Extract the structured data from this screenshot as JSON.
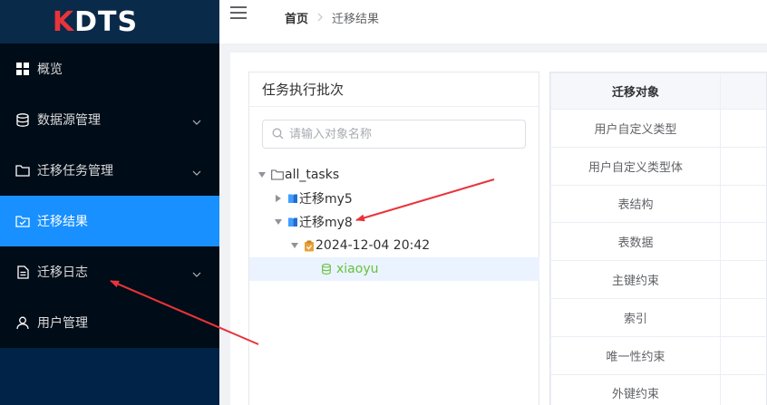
{
  "app": {
    "logo_k": "K",
    "logo_rest": "DTS"
  },
  "sidebar": {
    "items": [
      {
        "label": "概览",
        "icon": "grid-icon",
        "has_arrow": false,
        "active": false
      },
      {
        "label": "数据源管理",
        "icon": "database-icon",
        "has_arrow": true,
        "active": false
      },
      {
        "label": "迁移任务管理",
        "icon": "folder-icon",
        "has_arrow": true,
        "active": false
      },
      {
        "label": "迁移结果",
        "icon": "folder-check-icon",
        "has_arrow": false,
        "active": true
      },
      {
        "label": "迁移日志",
        "icon": "document-icon",
        "has_arrow": true,
        "active": false
      },
      {
        "label": "用户管理",
        "icon": "user-icon",
        "has_arrow": false,
        "active": false
      }
    ]
  },
  "header": {
    "breadcrumb_home": "首页",
    "breadcrumb_current": "迁移结果"
  },
  "tree_panel": {
    "title": "任务执行批次",
    "search_placeholder": "请输入对象名称",
    "nodes": {
      "root": "all_tasks",
      "task1": "迁移my5",
      "task2": "迁移my8",
      "batch": "2024-12-04 20:42",
      "db": "xiaoyu"
    }
  },
  "table": {
    "header": "迁移对象",
    "rows": [
      "用户自定义类型",
      "用户自定义类型体",
      "表结构",
      "表数据",
      "主键约束",
      "索引",
      "唯一性约束",
      "外键约束"
    ]
  },
  "colors": {
    "sidebar_bg": "#001529",
    "active_item": "#1890ff",
    "tree_selected": "#eaf3ff",
    "green_text": "#67c23a",
    "annotation_arrow": "#e8343a"
  }
}
